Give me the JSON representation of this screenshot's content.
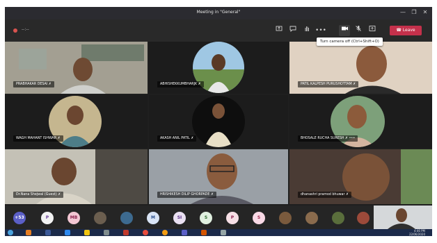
{
  "window": {
    "title": "Meeting in \"General\"",
    "minimize_glyph": "—",
    "maximize_glyph": "❐",
    "close_glyph": "✕"
  },
  "toolbar": {
    "timer": "--:--",
    "leave_label": "Leave",
    "more_label": "•••",
    "camera_tooltip": "Turn camera off (Ctrl+Shift+O)"
  },
  "participants": [
    {
      "name": "PRABHAKAR DESAI",
      "mic": "✗"
    },
    {
      "name": "ABHISHEKKUMBHARJK",
      "mic": "✗"
    },
    {
      "name": "PATIL KALPESH PURUSHOTTAM",
      "mic": "✗"
    },
    {
      "name": "WAGH MAHANT ISHWAR",
      "mic": "✗"
    },
    {
      "name": "AKASH ANIL PATIL",
      "mic": "✗"
    },
    {
      "name": "BHOSALE RUCHA SURESH",
      "mic": "✗ •••"
    },
    {
      "name": "Dr.Nana Shejwal (Guest)",
      "mic": "✗"
    },
    {
      "name": "HRISHIKESH DILIP GHORPADE",
      "mic": "✗"
    },
    {
      "name": "dhanashri pramod bhuwar",
      "mic": "✗"
    }
  ],
  "roster": [
    {
      "label": "+53",
      "color": "#5b5fc7"
    },
    {
      "label": "P",
      "color": "#f2f2f2",
      "text": "#6a3d9a"
    },
    {
      "label": "MB",
      "color": "#f3c6d3",
      "text": "#8a1f4b"
    },
    {
      "label": "",
      "color": "#6b5e4f"
    },
    {
      "label": "",
      "color": "#3d6a8f"
    },
    {
      "label": "M",
      "color": "#d9e4f5",
      "text": "#2b4f8c"
    },
    {
      "label": "SI",
      "color": "#e9e0f2",
      "text": "#5a2f85"
    },
    {
      "label": "S",
      "color": "#e0f0e0",
      "text": "#2c6a2c"
    },
    {
      "label": "P",
      "color": "#f6dfe6",
      "text": "#8c2250"
    },
    {
      "label": "S",
      "color": "#f9d9e6",
      "text": "#a0284f"
    },
    {
      "label": "",
      "color": "#7a5a3d"
    },
    {
      "label": "",
      "color": "#8a6b4d"
    },
    {
      "label": "",
      "color": "#5a6e3c"
    },
    {
      "label": "",
      "color": "#9c4a3a"
    }
  ],
  "taskbar": {
    "time": "4:46 PM",
    "date": "22/06/2020"
  },
  "colors": {
    "leave": "#c4314b",
    "accent": "#5b5fc7"
  }
}
